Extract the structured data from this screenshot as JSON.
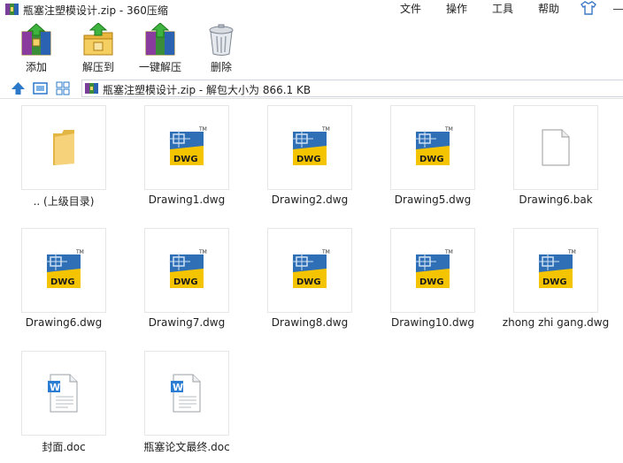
{
  "window": {
    "title": "瓶塞注塑模设计.zip - 360压缩"
  },
  "menu": {
    "file": "文件",
    "operate": "操作",
    "tools": "工具",
    "help": "帮助"
  },
  "toolbar": {
    "add": "添加",
    "extract_to": "解压到",
    "one_click_extract": "一键解压",
    "delete": "删除"
  },
  "address": {
    "path": "瓶塞注塑模设计.zip - 解包大小为 866.1 KB"
  },
  "files": [
    {
      "name": ".. (上级目录)",
      "type": "folder"
    },
    {
      "name": "Drawing1.dwg",
      "type": "dwg"
    },
    {
      "name": "Drawing2.dwg",
      "type": "dwg"
    },
    {
      "name": "Drawing5.dwg",
      "type": "dwg"
    },
    {
      "name": "Drawing6.bak",
      "type": "blank"
    },
    {
      "name": "Drawing6.dwg",
      "type": "dwg"
    },
    {
      "name": "Drawing7.dwg",
      "type": "dwg"
    },
    {
      "name": "Drawing8.dwg",
      "type": "dwg"
    },
    {
      "name": "Drawing10.dwg",
      "type": "dwg"
    },
    {
      "name": "zhong zhi gang.dwg",
      "type": "dwg"
    },
    {
      "name": "封面.doc",
      "type": "doc"
    },
    {
      "name": "瓶塞论文最终.doc",
      "type": "doc"
    }
  ],
  "colors": {
    "dwg_yellow": "#f5c400",
    "dwg_blue": "#2f6fb5",
    "folder": "#f3cd6a",
    "doc_blue": "#2b7cd3",
    "nav_blue": "#2b79c8"
  }
}
